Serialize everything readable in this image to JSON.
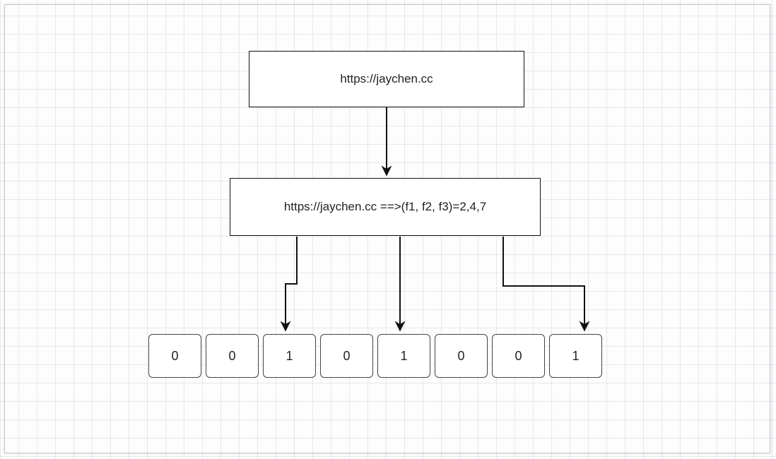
{
  "input_box": {
    "label": "https://jaychen.cc"
  },
  "hash_box": {
    "label": "https://jaychen.cc ==>(f1, f2, f3)=2,4,7"
  },
  "bit_array": {
    "cells": [
      "0",
      "0",
      "1",
      "0",
      "1",
      "0",
      "0",
      "1"
    ]
  }
}
